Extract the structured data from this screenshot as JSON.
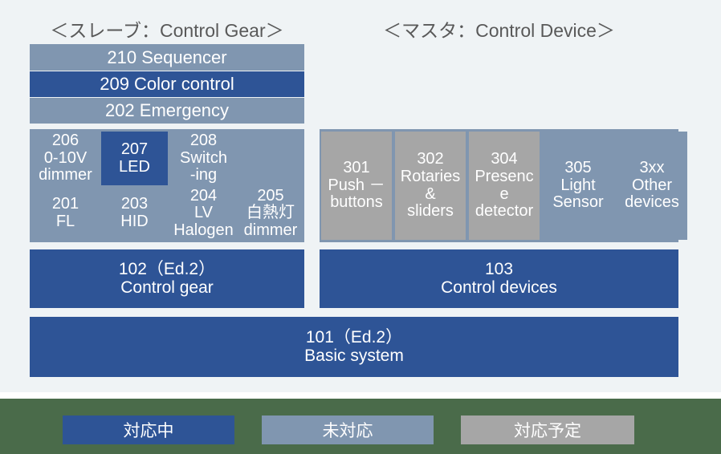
{
  "headings": {
    "slave": "＜スレーブ：Control Gear＞",
    "master": "＜マスタ：Control Device＞"
  },
  "colors": {
    "active_blue": "#2e5496",
    "not_supported_bluegray": "#8096b0",
    "planned_gray": "#a6a6a6",
    "background": "#eff3f5",
    "legend_band_green": "#4a6b4a",
    "text_heading": "#595959",
    "text_on_box": "#ffffff"
  },
  "slave_column": {
    "bars": [
      {
        "label": "210 Sequencer",
        "status": "not_supported"
      },
      {
        "label": "209 Color control",
        "status": "active"
      },
      {
        "label": "202 Emergency",
        "status": "not_supported"
      }
    ],
    "grid": {
      "row1": [
        {
          "lines": [
            "206",
            "0-10V",
            "dimmer"
          ],
          "status": "not_supported"
        },
        {
          "lines": [
            "207",
            "LED"
          ],
          "status": "active"
        },
        {
          "lines": [
            "208",
            "Switch",
            "-ing"
          ],
          "status": "not_supported"
        },
        {
          "lines": [],
          "status": "not_supported"
        }
      ],
      "row2": [
        {
          "lines": [
            "201",
            "FL"
          ],
          "status": "not_supported"
        },
        {
          "lines": [
            "203",
            "HID"
          ],
          "status": "not_supported"
        },
        {
          "lines": [
            "204",
            "LV",
            "Halogen"
          ],
          "status": "not_supported"
        },
        {
          "lines": [
            "205",
            "白熱灯",
            "dimmer"
          ],
          "status": "not_supported"
        }
      ]
    },
    "base_box": {
      "lines": [
        "102（Ed.2）",
        "Control gear"
      ],
      "status": "active"
    }
  },
  "master_column": {
    "grid": [
      {
        "lines": [
          "301",
          "Push －",
          "buttons"
        ],
        "status": "planned"
      },
      {
        "lines": [
          "302",
          "Rotaries",
          "&",
          "sliders"
        ],
        "status": "planned"
      },
      {
        "lines": [
          "304",
          "Presenc",
          "e",
          "detector"
        ],
        "status": "planned"
      },
      {
        "lines": [
          "305",
          "Light",
          "Sensor"
        ],
        "status": "not_supported"
      },
      {
        "lines": [
          "3xx",
          "Other",
          "devices"
        ],
        "status": "not_supported"
      }
    ],
    "base_box": {
      "lines": [
        "103",
        "Control devices"
      ],
      "status": "active"
    }
  },
  "foundation_box": {
    "lines": [
      "101（Ed.2）",
      "Basic system"
    ],
    "status": "active"
  },
  "legend": [
    {
      "label": "対応中",
      "status": "active"
    },
    {
      "label": "未対応",
      "status": "not_supported"
    },
    {
      "label": "対応予定",
      "status": "planned"
    }
  ]
}
